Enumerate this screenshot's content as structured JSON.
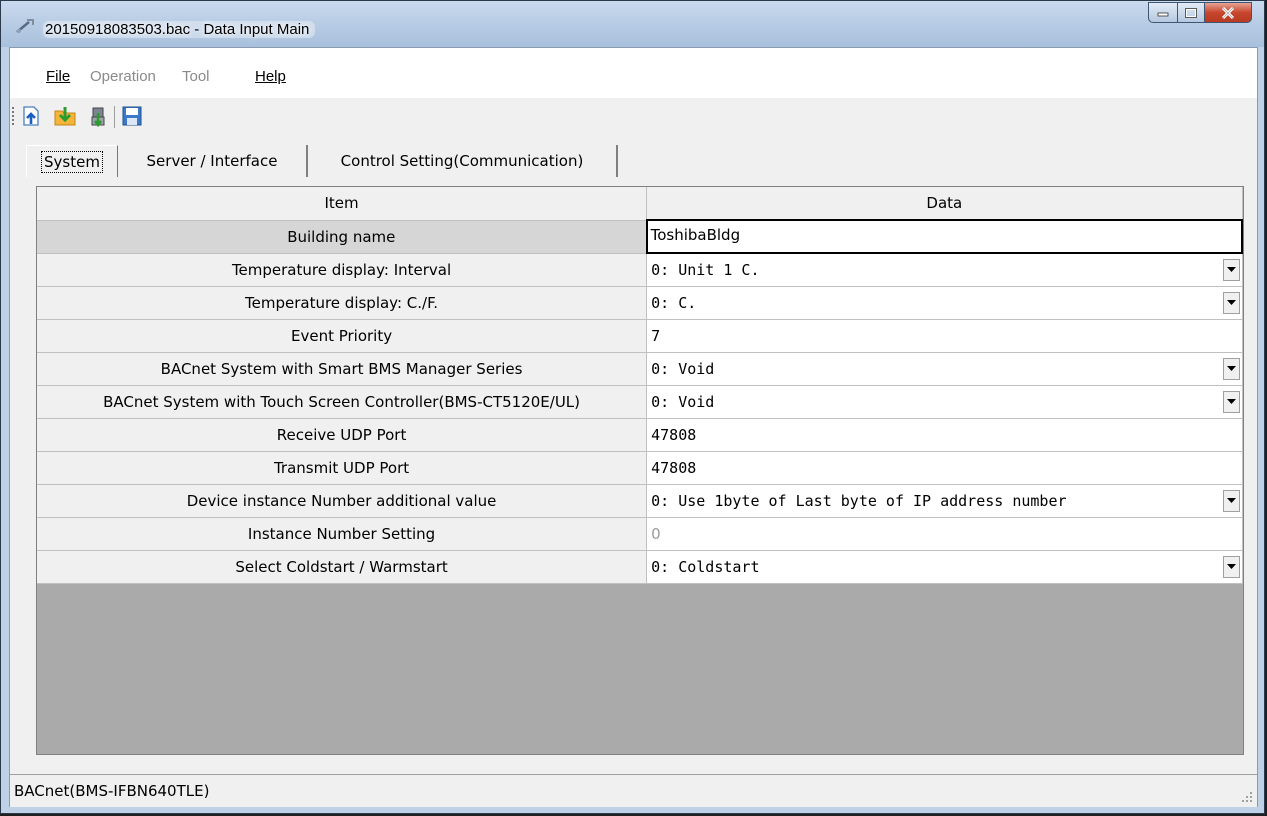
{
  "window": {
    "title": "20150918083503.bac - Data Input Main"
  },
  "menu": [
    {
      "label": "File",
      "enabled": true
    },
    {
      "label": "Operation",
      "enabled": false
    },
    {
      "label": "Tool",
      "enabled": false
    },
    {
      "label": "Help",
      "enabled": true
    }
  ],
  "toolbar": {
    "icons": [
      "open-file-icon",
      "import-icon",
      "download-icon",
      "save-icon"
    ]
  },
  "tabs": [
    {
      "label": "System",
      "active": true
    },
    {
      "label": "Server / Interface",
      "active": false
    },
    {
      "label": "Control Setting(Communication)",
      "active": false
    }
  ],
  "grid": {
    "headers": {
      "item": "Item",
      "data": "Data"
    },
    "rows": [
      {
        "item": "Building name",
        "value": "ToshibaBldg",
        "type": "edit"
      },
      {
        "item": "Temperature display: Interval",
        "value": "0: Unit 1 C.",
        "type": "combo"
      },
      {
        "item": "Temperature display: C./F.",
        "value": "0: C.",
        "type": "combo"
      },
      {
        "item": "Event Priority",
        "value": "7",
        "type": "text"
      },
      {
        "item": "BACnet System with Smart BMS Manager Series",
        "value": "0: Void",
        "type": "combo"
      },
      {
        "item": "BACnet System with Touch Screen Controller(BMS-CT5120E/UL)",
        "value": "0: Void",
        "type": "combo"
      },
      {
        "item": "Receive UDP Port",
        "value": "47808",
        "type": "text"
      },
      {
        "item": "Transmit UDP Port",
        "value": "47808",
        "type": "text"
      },
      {
        "item": "Device instance Number additional value",
        "value": "0: Use 1byte of Last byte of IP address number",
        "type": "combo"
      },
      {
        "item": "Instance Number Setting",
        "value": "0",
        "type": "disabled"
      },
      {
        "item": "Select Coldstart / Warmstart",
        "value": "0: Coldstart",
        "type": "combo"
      }
    ]
  },
  "statusbar": {
    "text": "BACnet(BMS-IFBN640TLE)"
  }
}
